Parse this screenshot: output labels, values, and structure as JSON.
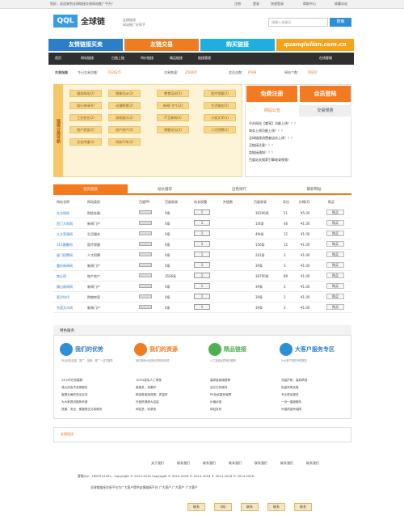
{
  "topbar": {
    "welcome": "您好，欢迎来到全球链接交易网站推广平台！",
    "login": "登录",
    "register": "注册",
    "quick": "快速登录",
    "help": "帮助中心",
    "fav": "收藏本站"
  },
  "logo": {
    "brand": "全球链",
    "mark": "QQL",
    "slogan1": "友情链接",
    "slogan2": "网站推广好帮手"
  },
  "search": {
    "placeholder": "请输入关键词",
    "button": "搜索"
  },
  "banners": [
    "友情链接买卖",
    "友链交易",
    "购买链接",
    "quanqiulian.com.cn"
  ],
  "nav": {
    "items": [
      "首页",
      "网站链接",
      "白链上链",
      "特价链接",
      "精品链接",
      "链接管理"
    ],
    "right": "在线客服"
  },
  "stats": {
    "label1": "交易指南",
    "l2": "今日交易总额：",
    "v2": "76362/5",
    "l3": "交易数量：",
    "v3": "256005",
    "l4": "会员总数：",
    "v4": "6568",
    "l5": "网站个数：",
    "v5": "78820"
  },
  "categories": {
    "vertical": "链接分类导航",
    "tags": [
      "服务网站(2)",
      "图像设计(2)",
      "教育培训(2)",
      "医疗保健(2)",
      "娱乐休闲(6)",
      "动漫影视(2)",
      "新闻门户(12)",
      "生活服务(5)",
      "工业农业(2)",
      "游戏娱乐(2)",
      "IT互联网(2)",
      "小说文学(1)",
      "地产家居(2)",
      "房产房产(2)",
      "博客论坛(2)",
      "人才招聘(2)",
      "文化传媒(2)",
      "科技汽车(2)"
    ]
  },
  "panel": {
    "free": "免费注册",
    "member": "会员登陆",
    "tab1": "网站公告",
    "tab2": "交易规则",
    "news": [
      "平台网站【尊享】功能上线！！！",
      "商务上线功能上线！！！",
      "全球链接消费者店庆上线！！！",
      "买链接注意！！！",
      "卖链接通知！！！",
      "百度站长搜索引擎收录视频！"
    ]
  },
  "tabs": [
    "首页链接",
    "站长推荐",
    "出售排行",
    "最新网站"
  ],
  "table": {
    "headers": [
      "网站名称",
      "网站类别",
      "百度PR",
      "百度收录",
      "站长权重",
      "外链数",
      "百度收录",
      "导出",
      "价格/月",
      "购买"
    ],
    "rows": [
      {
        "name": "东方财经",
        "cat": "财经金融",
        "pr": "",
        "idx": "0条",
        "w": "1",
        "out": "36200条",
        "ex": "51",
        "price": "¥5.00",
        "buy": "购买"
      },
      {
        "name": "西门大吹网",
        "cat": "新闻门户",
        "pr": "",
        "idx": "0条",
        "w": "1",
        "out": "14t条",
        "ex": "46",
        "price": "¥1.00",
        "buy": "购买"
      },
      {
        "name": "久久家政网",
        "cat": "生活服务",
        "pr": "",
        "idx": "0条",
        "w": "1",
        "out": "49t条",
        "ex": "12",
        "price": "¥1.00",
        "buy": "购买"
      },
      {
        "name": "315健康网",
        "cat": "医疗保健",
        "pr": "",
        "idx": "0条",
        "w": "1",
        "out": "156条",
        "ex": "12",
        "price": "¥1.00",
        "buy": "购买"
      },
      {
        "name": "厦门招聘网",
        "cat": "人才招聘",
        "pr": "",
        "idx": "0条",
        "w": "1",
        "out": "241条",
        "ex": "3",
        "price": "¥1.00",
        "buy": "购买"
      },
      {
        "name": "重庆新闻网",
        "cat": "新闻门户",
        "pr": "",
        "idx": "0条",
        "w": "1",
        "out": "39条",
        "ex": "3",
        "price": "¥1.00",
        "buy": "购买"
      },
      {
        "name": "商丘网",
        "cat": "地产房产",
        "pr": "",
        "idx": "3506条",
        "w": "1",
        "out": "18700条",
        "ex": "89",
        "price": "¥1.00",
        "buy": "购买"
      },
      {
        "name": "佛山新闻网",
        "cat": "新闻门户",
        "pr": "",
        "idx": "0条",
        "w": "1",
        "out": "39条",
        "ex": "3",
        "price": "¥1.00",
        "buy": "购买"
      },
      {
        "name": "夏汐时代",
        "cat": "购物房家",
        "pr": "",
        "idx": "0条",
        "w": "1",
        "out": "39条",
        "ex": "3",
        "price": "¥1.00",
        "buy": "购买"
      },
      {
        "name": "东莞天众网",
        "cat": "新闻门户",
        "pr": "",
        "idx": "0条",
        "w": "1",
        "out": "39条",
        "ex": "3",
        "price": "¥1.00",
        "buy": "购买"
      }
    ]
  },
  "services": {
    "heading": "特色服务",
    "cols": [
      {
        "title": "我们的优势",
        "desc": "专业网站友链、推广、营销、推广一站式服务",
        "items": [
          "24小时在线客服",
          "强大的会员资源服务",
          "客服全面的安全支持",
          "为大家提供推荐资源",
          "快速、安全、便捷提交交易服务"
        ]
      },
      {
        "title": "我们的资源",
        "desc": "我们拥有大量的优质网站资源",
        "items": [
          "100%真实人工审核",
          "链接多，效果好",
          "精选各链接资源，质量好",
          "外链资源超大容量",
          "网站多，收录快"
        ]
      },
      {
        "title": "精品链接",
        "desc": "人工挑选优质网站推荐",
        "items": [
          "高质量链接推荐",
          "站长无忧服务",
          "PR及权重有保障",
          "价格优惠",
          "网站发布"
        ]
      },
      {
        "title": "大客户服务专区",
        "desc": "为大客户提供专属服务",
        "items": [
          "流量护航，高效精准",
          "批量采购优惠",
          "专业售后服务",
          "一对一客服服务",
          "外链质量有保障"
        ]
      }
    ]
  },
  "friend": {
    "label": "友情链接"
  },
  "footer": {
    "links": [
      "关于我们",
      "联系我们",
      "联系我们",
      "联系我们",
      "联系我们",
      "联系我们",
      "联系我们"
    ],
    "copy": "客服QQ：1697512261，Copyright © 2014-2016 Copyright © 2014-2016 © 2014-2016 © 2014-2016 © 2014-2016",
    "note": "全球链链接交易平台为广大客户提供友情链接平台 广大客户 广大客户 广大客户",
    "badges": [
      "联系",
      "QQ",
      "联系",
      "联系",
      "联系"
    ]
  }
}
